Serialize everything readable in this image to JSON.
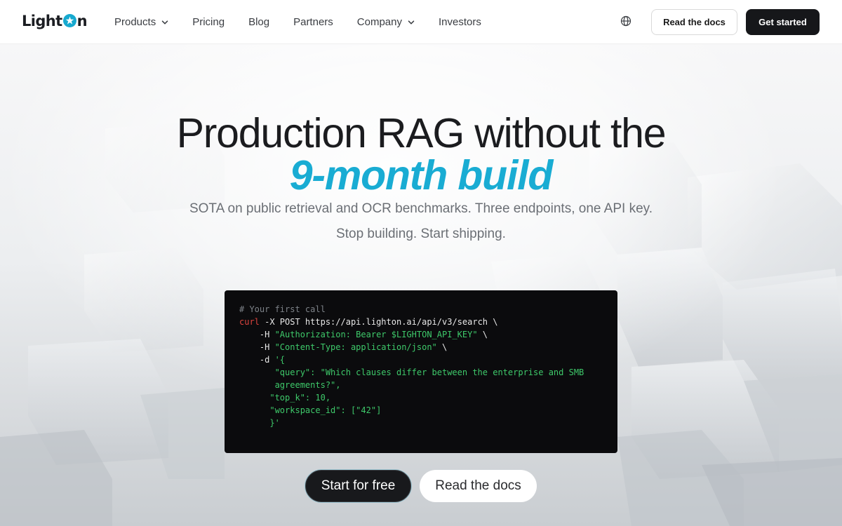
{
  "brand": {
    "logo_text_left": "Light",
    "logo_text_right": "n",
    "accent_color": "#19acd3"
  },
  "nav": {
    "items": [
      {
        "label": "Products",
        "has_dropdown": true
      },
      {
        "label": "Pricing",
        "has_dropdown": false
      },
      {
        "label": "Blog",
        "has_dropdown": false
      },
      {
        "label": "Partners",
        "has_dropdown": false
      },
      {
        "label": "Company",
        "has_dropdown": true
      },
      {
        "label": "Investors",
        "has_dropdown": false
      }
    ],
    "language_icon": "globe-icon",
    "read_docs_label": "Read the docs",
    "get_started_label": "Get started"
  },
  "hero": {
    "headline": "Production RAG without the",
    "headline_accent": "9-month build",
    "subtitle_line1": "SOTA on public retrieval and OCR benchmarks. Three endpoints, one API key.",
    "subtitle_line2": "Stop building. Start shipping."
  },
  "code_sample": {
    "comment": "# Your first call",
    "command": "curl",
    "line1_rest": " -X POST https://api.lighton.ai/api/v3/search \\",
    "line2_flag": "    -H ",
    "line2_str": "\"Authorization: Bearer $LIGHTON_API_KEY\"",
    "line2_tail": " \\",
    "line3_flag": "    -H ",
    "line3_str": "\"Content-Type: application/json\"",
    "line3_tail": " \\",
    "line4_flag": "    -d ",
    "line4_str": "'{",
    "line5": "       \"query\": \"Which clauses differ between the enterprise and SMB",
    "line6": "       agreements?\",",
    "line7": "      \"top_k\": 10,",
    "line8": "      \"workspace_id\": [\"42\"]",
    "line9": "      }'"
  },
  "cta": {
    "start_label": "Start for free",
    "docs_label": "Read the docs"
  }
}
